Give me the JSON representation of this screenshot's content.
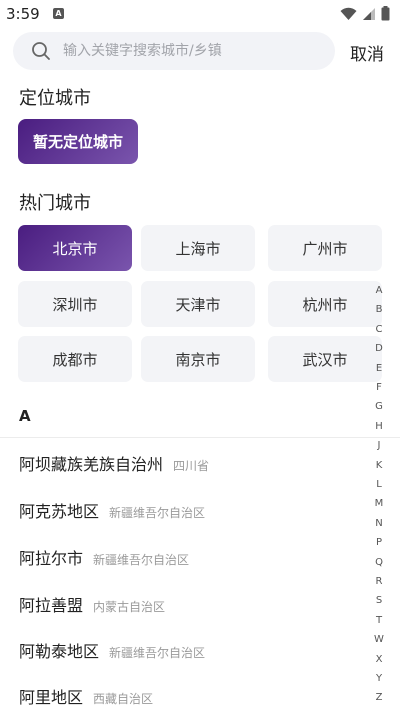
{
  "status_bar": {
    "time": "3:59",
    "notification_glyph": "A"
  },
  "search": {
    "placeholder": "输入关键字搜索城市/乡镇",
    "value": "",
    "cancel_label": "取消"
  },
  "location": {
    "title": "定位城市",
    "current_label": "暂无定位城市"
  },
  "hot_cities": {
    "title": "热门城市",
    "items": [
      "北京市",
      "上海市",
      "广州市",
      "深圳市",
      "天津市",
      "杭州市",
      "成都市",
      "南京市",
      "武汉市"
    ],
    "selected": "北京市"
  },
  "list": {
    "current_letter": "A",
    "items": [
      {
        "name": "阿坝藏族羌族自治州",
        "region": "四川省"
      },
      {
        "name": "阿克苏地区",
        "region": "新疆维吾尔自治区"
      },
      {
        "name": "阿拉尔市",
        "region": "新疆维吾尔自治区"
      },
      {
        "name": "阿拉善盟",
        "region": "内蒙古自治区"
      },
      {
        "name": "阿勒泰地区",
        "region": "新疆维吾尔自治区"
      },
      {
        "name": "阿里地区",
        "region": "西藏自治区"
      }
    ]
  },
  "index_bar": [
    "A",
    "B",
    "C",
    "D",
    "E",
    "F",
    "G",
    "H",
    "J",
    "K",
    "L",
    "M",
    "N",
    "P",
    "Q",
    "R",
    "S",
    "T",
    "W",
    "X",
    "Y",
    "Z"
  ],
  "colors": {
    "accent_start": "#4a1d80",
    "accent_end": "#7a55ad",
    "chip_bg": "#f3f4f7"
  }
}
